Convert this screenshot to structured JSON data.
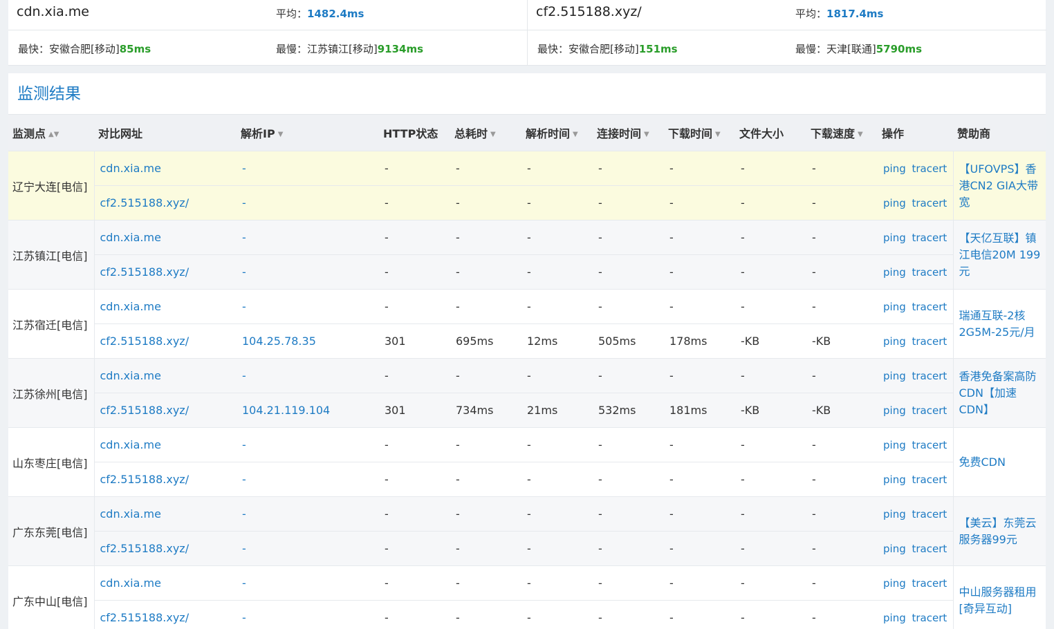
{
  "summary": {
    "left": {
      "domain": "cdn.xia.me",
      "avg_label": "平均：",
      "avg_value": "1482.4ms",
      "fast_label": "最快：",
      "fast_place": "安徽合肥[移动]",
      "fast_value": "85ms",
      "slow_label": "最慢：",
      "slow_place": "江苏镇江[移动]",
      "slow_value": "9134ms"
    },
    "right": {
      "domain": "cf2.515188.xyz/",
      "avg_label": "平均：",
      "avg_value": "1817.4ms",
      "fast_label": "最快：",
      "fast_place": "安徽合肥[移动]",
      "fast_value": "151ms",
      "slow_label": "最慢：",
      "slow_place": "天津[联通]",
      "slow_value": "5790ms"
    }
  },
  "panel_title": "监测结果",
  "headers": [
    "监测点",
    "对比网址",
    "解析IP",
    "HTTP状态",
    "总耗时",
    "解析时间",
    "连接时间",
    "下载时间",
    "文件大小",
    "下载速度",
    "操作",
    "赞助商"
  ],
  "ops": {
    "ping": "ping",
    "tracert": "tracert"
  },
  "groups": [
    {
      "place": "辽宁大连[电信]",
      "sponsor": "【UFOVPS】香港CN2 GIA大带宽",
      "rows": [
        {
          "url": "cdn.xia.me",
          "ip": "-",
          "http": "-",
          "total": "-",
          "dns": "-",
          "connect": "-",
          "download": "-",
          "size": "-",
          "speed": "-"
        },
        {
          "url": "cf2.515188.xyz/",
          "ip": "-",
          "http": "-",
          "total": "-",
          "dns": "-",
          "connect": "-",
          "download": "-",
          "size": "-",
          "speed": "-"
        }
      ]
    },
    {
      "place": "江苏镇江[电信]",
      "sponsor": "【天亿互联】镇江电信20M 199元",
      "rows": [
        {
          "url": "cdn.xia.me",
          "ip": "-",
          "http": "-",
          "total": "-",
          "dns": "-",
          "connect": "-",
          "download": "-",
          "size": "-",
          "speed": "-"
        },
        {
          "url": "cf2.515188.xyz/",
          "ip": "-",
          "http": "-",
          "total": "-",
          "dns": "-",
          "connect": "-",
          "download": "-",
          "size": "-",
          "speed": "-"
        }
      ]
    },
    {
      "place": "江苏宿迁[电信]",
      "sponsor": "瑞通互联-2核2G5M-25元/月",
      "rows": [
        {
          "url": "cdn.xia.me",
          "ip": "-",
          "http": "-",
          "total": "-",
          "dns": "-",
          "connect": "-",
          "download": "-",
          "size": "-",
          "speed": "-"
        },
        {
          "url": "cf2.515188.xyz/",
          "ip": "104.25.78.35",
          "http": "301",
          "total": "695ms",
          "dns": "12ms",
          "connect": "505ms",
          "download": "178ms",
          "size": "-KB",
          "speed": "-KB"
        }
      ]
    },
    {
      "place": "江苏徐州[电信]",
      "sponsor": "香港免备案高防CDN【加速CDN】",
      "rows": [
        {
          "url": "cdn.xia.me",
          "ip": "-",
          "http": "-",
          "total": "-",
          "dns": "-",
          "connect": "-",
          "download": "-",
          "size": "-",
          "speed": "-"
        },
        {
          "url": "cf2.515188.xyz/",
          "ip": "104.21.119.104",
          "http": "301",
          "total": "734ms",
          "dns": "21ms",
          "connect": "532ms",
          "download": "181ms",
          "size": "-KB",
          "speed": "-KB"
        }
      ]
    },
    {
      "place": "山东枣庄[电信]",
      "sponsor": "免费CDN",
      "rows": [
        {
          "url": "cdn.xia.me",
          "ip": "-",
          "http": "-",
          "total": "-",
          "dns": "-",
          "connect": "-",
          "download": "-",
          "size": "-",
          "speed": "-"
        },
        {
          "url": "cf2.515188.xyz/",
          "ip": "-",
          "http": "-",
          "total": "-",
          "dns": "-",
          "connect": "-",
          "download": "-",
          "size": "-",
          "speed": "-"
        }
      ]
    },
    {
      "place": "广东东莞[电信]",
      "sponsor": "【美云】东莞云服务器99元",
      "rows": [
        {
          "url": "cdn.xia.me",
          "ip": "-",
          "http": "-",
          "total": "-",
          "dns": "-",
          "connect": "-",
          "download": "-",
          "size": "-",
          "speed": "-"
        },
        {
          "url": "cf2.515188.xyz/",
          "ip": "-",
          "http": "-",
          "total": "-",
          "dns": "-",
          "connect": "-",
          "download": "-",
          "size": "-",
          "speed": "-"
        }
      ]
    },
    {
      "place": "广东中山[电信]",
      "sponsor": "中山服务器租用[奇异互动]",
      "rows": [
        {
          "url": "cdn.xia.me",
          "ip": "-",
          "http": "-",
          "total": "-",
          "dns": "-",
          "connect": "-",
          "download": "-",
          "size": "-",
          "speed": "-"
        },
        {
          "url": "cf2.515188.xyz/",
          "ip": "-",
          "http": "-",
          "total": "-",
          "dns": "-",
          "connect": "-",
          "download": "-",
          "size": "-",
          "speed": "-"
        }
      ]
    }
  ],
  "colors": {
    "accent": "#1e7bc4",
    "good": "#2a9d2a",
    "highlight": "#fbfbdf"
  }
}
